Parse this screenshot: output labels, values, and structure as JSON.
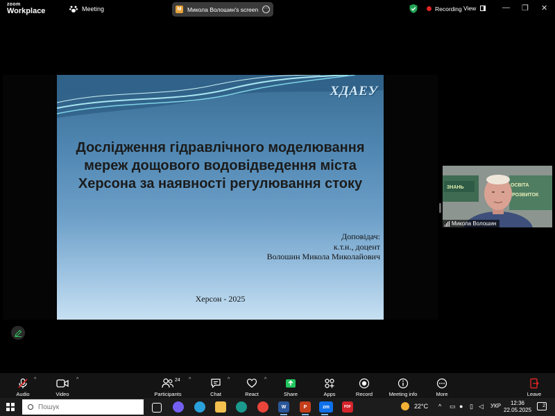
{
  "app": {
    "brand_small": "zoom",
    "brand_large": "Workplace",
    "meeting_label": "Meeting",
    "screen_share_label": "Микола Волошин's screen",
    "screen_share_badge": "M",
    "more_glyph": "···",
    "recording_label": "Recording",
    "view_label": "View",
    "window_controls": {
      "minimize": "—",
      "maximize": "❐",
      "close": "✕"
    },
    "accent_color": "#0e71eb",
    "recording_color": "#e02424"
  },
  "slide": {
    "logo": "ХДАЕУ",
    "title_lines": [
      "Дослідження гідравлічного моделювання",
      "мереж дощового водовідведення міста",
      "Херсона за наявності регулювання стоку"
    ],
    "reporter_lines": [
      "Доповідач:",
      "к.т.н., доцент",
      "Волошин Микола Миколайович"
    ],
    "city_year": "Херсон - 2025"
  },
  "participant": {
    "name": "Микола Волошин",
    "background_text": [
      "ЗНАНЬ",
      "ОСВІТА",
      "РОЗВИТОК"
    ]
  },
  "toolbar": {
    "audio": "Audio",
    "video": "Video",
    "participants": "Participants",
    "participants_count": "24",
    "chat": "Chat",
    "react": "React",
    "share": "Share",
    "apps": "Apps",
    "record": "Record",
    "meeting_info": "Meeting info",
    "more": "More",
    "leave": "Leave",
    "share_color": "#22c55e",
    "leave_color": "#e02424"
  },
  "taskbar": {
    "search_placeholder": "Пошук",
    "apps": [
      "W",
      "P",
      "zm",
      "PDF"
    ],
    "weather": "22°C",
    "language": "УКР",
    "time": "12:36",
    "date": "22.05.2025",
    "notifications": "2"
  }
}
